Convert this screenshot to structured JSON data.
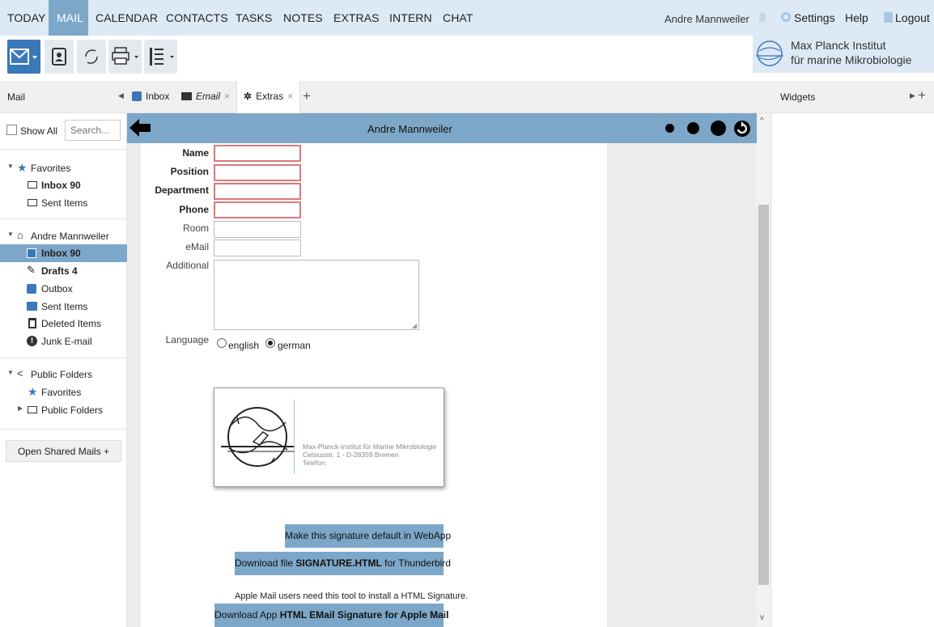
{
  "nav": {
    "today": "TODAY",
    "mail": "MAIL",
    "calendar": "CALENDAR",
    "contacts": "CONTACTS",
    "tasks": "TASKS",
    "notes": "NOTES",
    "extras": "EXTRAS",
    "intern": "INTERN",
    "chat": "CHAT",
    "user": "Andre Mannweiler",
    "settings": "Settings",
    "help": "Help",
    "logout": "Logout"
  },
  "brand": {
    "line1": "Max Planck Institut",
    "line2": "für marine Mikrobiologie"
  },
  "header": {
    "mail": "Mail",
    "tabs": [
      {
        "label": "Inbox",
        "close": ""
      },
      {
        "label": "Email",
        "close": "×"
      },
      {
        "label": "Extras",
        "close": "×"
      }
    ],
    "add_tab": "+",
    "widgets": "Widgets",
    "widgets_add": "+"
  },
  "sidebar": {
    "show_all": "Show All",
    "search_placeholder": "Search...",
    "favorites": "Favorites",
    "fav_inbox": "Inbox 90",
    "fav_sent": "Sent Items",
    "account": "Andre Mannweiler",
    "inbox": "Inbox 90",
    "drafts": "Drafts 4",
    "outbox": "Outbox",
    "sent": "Sent Items",
    "deleted": "Deleted Items",
    "junk": "Junk E-mail",
    "public": "Public Folders",
    "pub_favorites": "Favorites",
    "pub_folders": "Public Folders",
    "open_shared": "Open Shared Mails +"
  },
  "content": {
    "title": "Andre Mannweiler",
    "fields": {
      "name": "Name",
      "position": "Position",
      "department": "Department",
      "phone": "Phone",
      "room": "Room",
      "email": "eMail",
      "additional": "Additional",
      "language": "Language"
    },
    "lang_english": "english",
    "lang_german": "german",
    "selected_language": "german",
    "signature": {
      "line1": "Max-Planck-Institut für Marine Mikrobiologie",
      "line2": "Celsiusstr. 1 - D-28359 Bremen",
      "line3": "Telefon:"
    },
    "btn_default": "Make this signature default in WebApp",
    "btn_download_pre": "Download file ",
    "btn_download_bold": "SIGNATURE.HTML",
    "btn_download_post": " for Thunderbird",
    "apple_note": "Apple Mail users need this tool to install a HTML Signature.",
    "btn_apple_pre": "Download App ",
    "btn_apple_bold": "HTML EMail Signature for Apple Mail"
  },
  "colors": {
    "accent": "#7da7c8",
    "topbar": "#dde9f5",
    "required_border": "#d97a7a",
    "active_button": "#3a78b8"
  }
}
